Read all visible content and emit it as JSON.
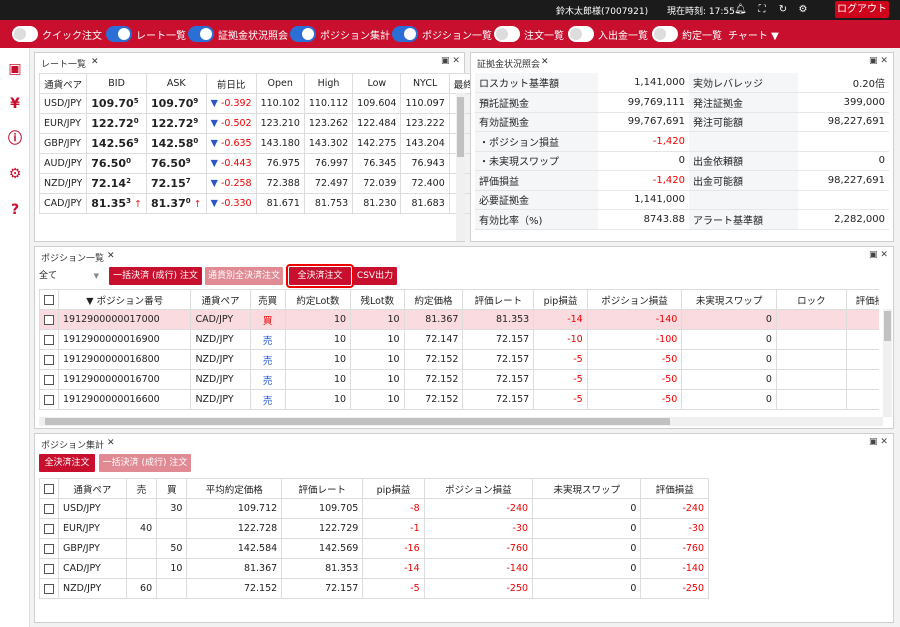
{
  "header": {
    "user": "鈴木太郎様(7007921)",
    "clock": "現在時刻: 17:55",
    "logout": "ログアウト",
    "icons": [
      "bell-icon",
      "fullscreen-icon",
      "refresh-icon",
      "gear-icon"
    ]
  },
  "toolbar": {
    "items": [
      {
        "label": "クイック注文",
        "on": false
      },
      {
        "label": "レート一覧",
        "on": true
      },
      {
        "label": "証拠金状況照会",
        "on": true
      },
      {
        "label": "ポジション集計",
        "on": true
      },
      {
        "label": "ポジション一覧",
        "on": true
      },
      {
        "label": "注文一覧",
        "on": false
      },
      {
        "label": "入出金一覧",
        "on": false
      },
      {
        "label": "約定一覧",
        "on": false
      }
    ],
    "chart": "チャート ▼"
  },
  "sidebar": {
    "icons": [
      "save-icon",
      "yen-icon",
      "info-icon",
      "gear-icon",
      "help-icon"
    ]
  },
  "rate_panel": {
    "title": "レート一覧",
    "headers": [
      "通貨ペア",
      "BID",
      "ASK",
      "前日比",
      "Open",
      "High",
      "Low",
      "NYCL",
      "最終"
    ],
    "rows": [
      {
        "pair": "USD/JPY",
        "bid_main": "109.70",
        "bid_sup": "5",
        "ask_main": "109.70",
        "ask_sup": "9",
        "dir": "▼",
        "change": "-0.392",
        "open": "110.102",
        "high": "110.112",
        "low": "109.604",
        "nycl": "110.097",
        "arrow": ""
      },
      {
        "pair": "EUR/JPY",
        "bid_main": "122.72",
        "bid_sup": "0",
        "ask_main": "122.72",
        "ask_sup": "9",
        "dir": "▼",
        "change": "-0.502",
        "open": "123.210",
        "high": "123.262",
        "low": "122.484",
        "nycl": "123.222",
        "arrow": ""
      },
      {
        "pair": "GBP/JPY",
        "bid_main": "142.56",
        "bid_sup": "9",
        "ask_main": "142.58",
        "ask_sup": "0",
        "dir": "▼",
        "change": "-0.635",
        "open": "143.180",
        "high": "143.302",
        "low": "142.275",
        "nycl": "143.204",
        "arrow": ""
      },
      {
        "pair": "AUD/JPY",
        "bid_main": "76.50",
        "bid_sup": "0",
        "ask_main": "76.50",
        "ask_sup": "9",
        "dir": "▼",
        "change": "-0.443",
        "open": "76.975",
        "high": "76.997",
        "low": "76.345",
        "nycl": "76.943",
        "arrow": ""
      },
      {
        "pair": "NZD/JPY",
        "bid_main": "72.14",
        "bid_sup": "2",
        "ask_main": "72.15",
        "ask_sup": "7",
        "dir": "▼",
        "change": "-0.258",
        "open": "72.388",
        "high": "72.497",
        "low": "72.039",
        "nycl": "72.400",
        "arrow": ""
      },
      {
        "pair": "CAD/JPY",
        "bid_main": "81.35",
        "bid_sup": "3",
        "ask_main": "81.37",
        "ask_sup": "0",
        "dir": "▼",
        "change": "-0.330",
        "open": "81.671",
        "high": "81.753",
        "low": "81.230",
        "nycl": "81.683",
        "arrow": "↑"
      }
    ]
  },
  "margin_panel": {
    "title": "証拠金状況照会",
    "rows": [
      {
        "k1": "ロスカット基準額",
        "v1": "1,141,000",
        "k2": "実効レバレッジ",
        "v2": "0.20倍",
        "neg1": false
      },
      {
        "k1": "預託証拠金",
        "v1": "99,769,111",
        "k2": "発注証拠金",
        "v2": "399,000",
        "neg1": false
      },
      {
        "k1": "有効証拠金",
        "v1": "99,767,691",
        "k2": "発注可能額",
        "v2": "98,227,691",
        "neg1": false
      },
      {
        "k1": "・ポジション損益",
        "v1": "-1,420",
        "k2": "",
        "v2": "",
        "neg1": true
      },
      {
        "k1": "・未実現スワップ",
        "v1": "0",
        "k2": "出金依頼額",
        "v2": "0",
        "neg1": false
      },
      {
        "k1": "評価損益",
        "v1": "-1,420",
        "k2": "出金可能額",
        "v2": "98,227,691",
        "neg1": true
      },
      {
        "k1": "必要証拠金",
        "v1": "1,141,000",
        "k2": "",
        "v2": "",
        "neg1": false
      },
      {
        "k1": "有効比率（%)",
        "v1": "8743.88",
        "k2": "アラート基準額",
        "v2": "2,282,000",
        "neg1": false
      }
    ]
  },
  "position_panel": {
    "title": "ポジション一覧",
    "filter": "全て",
    "buttons": [
      "一括決済 (成行) 注文",
      "通貨別全決済注文",
      "全決済注文",
      "CSV出力"
    ],
    "headers": [
      "▼ ポジション番号",
      "通貨ペア",
      "売買",
      "約定Lot数",
      "残Lot数",
      "約定価格",
      "評価レート",
      "pip損益",
      "ポジション損益",
      "未実現スワップ",
      "ロック",
      "評価損"
    ],
    "rows": [
      {
        "id": "1912900000017000",
        "pair": "CAD/JPY",
        "side": "買",
        "lot": "10",
        "rem": "10",
        "price": "81.367",
        "rate": "81.353",
        "pip": "-14",
        "pl": "-140",
        "swap": "0"
      },
      {
        "id": "1912900000016900",
        "pair": "NZD/JPY",
        "side": "売",
        "lot": "10",
        "rem": "10",
        "price": "72.147",
        "rate": "72.157",
        "pip": "-10",
        "pl": "-100",
        "swap": "0"
      },
      {
        "id": "1912900000016800",
        "pair": "NZD/JPY",
        "side": "売",
        "lot": "10",
        "rem": "10",
        "price": "72.152",
        "rate": "72.157",
        "pip": "-5",
        "pl": "-50",
        "swap": "0"
      },
      {
        "id": "1912900000016700",
        "pair": "NZD/JPY",
        "side": "売",
        "lot": "10",
        "rem": "10",
        "price": "72.152",
        "rate": "72.157",
        "pip": "-5",
        "pl": "-50",
        "swap": "0"
      },
      {
        "id": "1912900000016600",
        "pair": "NZD/JPY",
        "side": "売",
        "lot": "10",
        "rem": "10",
        "price": "72.152",
        "rate": "72.157",
        "pip": "-5",
        "pl": "-50",
        "swap": "0"
      }
    ]
  },
  "summary_panel": {
    "title": "ポジション集計",
    "buttons": [
      "全決済注文",
      "一括決済 (成行) 注文"
    ],
    "headers": [
      "通貨ペア",
      "売",
      "買",
      "平均約定価格",
      "評価レート",
      "pip損益",
      "ポジション損益",
      "未実現スワップ",
      "評価損益"
    ],
    "rows": [
      {
        "pair": "USD/JPY",
        "sell": "",
        "buy": "30",
        "avg": "109.712",
        "rate": "109.705",
        "pip": "-8",
        "pl": "-240",
        "swap": "0",
        "eval": "-240"
      },
      {
        "pair": "EUR/JPY",
        "sell": "40",
        "buy": "",
        "avg": "122.728",
        "rate": "122.729",
        "pip": "-1",
        "pl": "-30",
        "swap": "0",
        "eval": "-30"
      },
      {
        "pair": "GBP/JPY",
        "sell": "",
        "buy": "50",
        "avg": "142.584",
        "rate": "142.569",
        "pip": "-16",
        "pl": "-760",
        "swap": "0",
        "eval": "-760"
      },
      {
        "pair": "CAD/JPY",
        "sell": "",
        "buy": "10",
        "avg": "81.367",
        "rate": "81.353",
        "pip": "-14",
        "pl": "-140",
        "swap": "0",
        "eval": "-140"
      },
      {
        "pair": "NZD/JPY",
        "sell": "60",
        "buy": "",
        "avg": "72.152",
        "rate": "72.157",
        "pip": "-5",
        "pl": "-250",
        "swap": "0",
        "eval": "-250"
      }
    ]
  }
}
